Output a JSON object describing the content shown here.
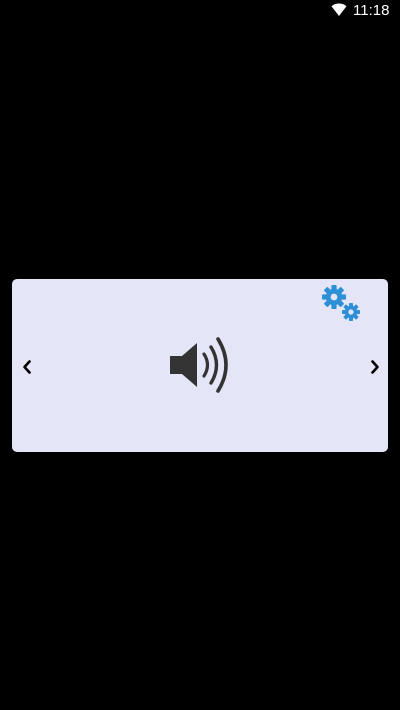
{
  "status_bar": {
    "time": "11:18",
    "wifi_icon": "wifi-icon"
  },
  "player_panel": {
    "background": "#e5e5f8",
    "prev_icon": "chevron-left-icon",
    "next_icon": "chevron-right-icon",
    "sound_icon": "speaker-volume-icon",
    "settings_icon": "gears-icon",
    "accent": "#2d8fd5"
  }
}
